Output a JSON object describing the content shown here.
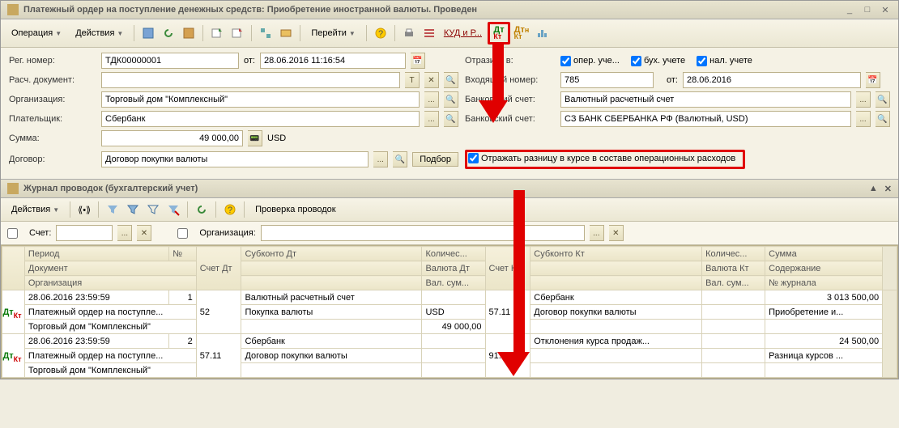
{
  "window": {
    "title": "Платежный ордер на поступление денежных средств: Приобретение иностранной валюты. Проведен"
  },
  "toolbar1": {
    "operation": "Операция",
    "actions": "Действия",
    "goto": "Перейти",
    "kud": "КУД и Р..."
  },
  "form": {
    "reg_label": "Рег. номер:",
    "reg_value": "ТДК00000001",
    "from_label": "от:",
    "date_value": "28.06.2016 11:16:54",
    "reflect_label": "Отразить в:",
    "chk_oper": "опер. уче...",
    "chk_buh": "бух. учете",
    "chk_nal": "нал. учете",
    "doc_label": "Расч. документ:",
    "incoming_label": "Входящий номер:",
    "incoming_value": "785",
    "from2_label": "от:",
    "incoming_date": "28.06.2016",
    "org_label": "Организация:",
    "org_value": "Торговый дом \"Комплексный\"",
    "bank_acc_label": "Банковский счет:",
    "bank_acc_value": "Валютный расчетный счет",
    "payer_label": "Плательщик:",
    "payer_value": "Сбербанк",
    "bank_acc2_label": "Банковский счет:",
    "bank_acc2_value": "СЗ БАНК СБЕРБАНКА РФ (Валютный, USD)",
    "sum_label": "Сумма:",
    "sum_value": "49 000,00",
    "currency": "USD",
    "contract_label": "Договор:",
    "contract_value": "Договор покупки валюты",
    "podbor": "Подбор",
    "reflect_diff": "Отражать разницу в курсе в составе операционных расходов"
  },
  "journal": {
    "title": "Журнал проводок (бухгалтерский учет)",
    "actions": "Действия",
    "check": "Проверка проводок",
    "filter_account": "Счет:",
    "filter_org": "Организация:"
  },
  "table": {
    "headers": {
      "period": "Период",
      "num": "№",
      "acc_dt": "Счет Дт",
      "sub_dt": "Субконто Дт",
      "qty": "Количес...",
      "acc_kt": "Счет Кт",
      "sub_kt": "Субконто Кт",
      "qty2": "Количес...",
      "sum": "Сумма",
      "document": "Документ",
      "val_dt": "Валюта Дт",
      "val_kt": "Валюта Кт",
      "content": "Содержание",
      "organization": "Организация",
      "valsum": "Вал. сум...",
      "valsum2": "Вал. сум...",
      "journal_num": "№ журнала"
    },
    "rows": [
      {
        "period": "28.06.2016 23:59:59",
        "num": "1",
        "acc_dt": "52",
        "sub_dt1": "Валютный расчетный счет",
        "acc_kt": "57.11",
        "sub_kt1": "Сбербанк",
        "sum": "3 013 500,00",
        "document": "Платежный ордер на поступле...",
        "sub_dt2": "Покупка валюты",
        "val_dt": "USD",
        "sub_kt2": "Договор покупки валюты",
        "content": "Приобретение и...",
        "organization": "Торговый дом \"Комплексный\"",
        "valsum": "49 000,00",
        "journal_num": ""
      },
      {
        "period": "28.06.2016 23:59:59",
        "num": "2",
        "acc_dt": "57.11",
        "sub_dt1": "Сбербанк",
        "acc_kt": "91.01",
        "sub_kt1": "Отклонения курса продаж...",
        "sum": "24 500,00",
        "document": "Платежный ордер на поступле...",
        "sub_dt2": "Договор покупки валюты",
        "content": "Разница курсов ...",
        "organization": "Торговый дом \"Комплексный\""
      }
    ]
  }
}
